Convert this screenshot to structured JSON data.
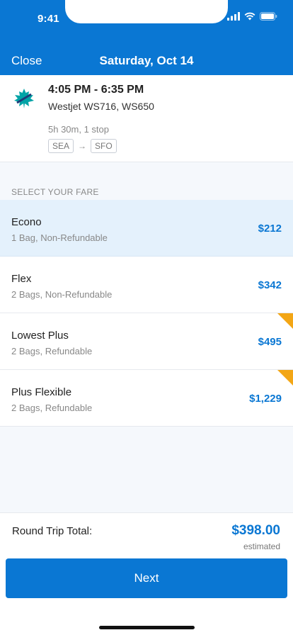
{
  "status_bar": {
    "time": "9:41"
  },
  "header": {
    "close_label": "Close",
    "title": "Saturday, Oct 14"
  },
  "flight": {
    "airline_icon": "westjet-maple-leaf-logo",
    "times": "4:05 PM - 6:35 PM",
    "flight_numbers": "Westjet WS716, WS650",
    "duration": "5h 30m, 1 stop",
    "origin": "SEA",
    "destination": "SFO"
  },
  "fares": {
    "heading": "SELECT YOUR FARE",
    "items": [
      {
        "name": "Econo",
        "detail": "1 Bag, Non-Refundable",
        "price": "$212",
        "selected": true,
        "flagged": false
      },
      {
        "name": "Flex",
        "detail": "2 Bags, Non-Refundable",
        "price": "$342",
        "selected": false,
        "flagged": false
      },
      {
        "name": "Lowest Plus",
        "detail": "2 Bags, Refundable",
        "price": "$495",
        "selected": false,
        "flagged": true
      },
      {
        "name": "Plus Flexible",
        "detail": "2 Bags, Refundable",
        "price": "$1,229",
        "selected": false,
        "flagged": true
      }
    ]
  },
  "total": {
    "label": "Round Trip Total:",
    "amount": "$398.00",
    "note": "estimated"
  },
  "next_label": "Next",
  "colors": {
    "brand": "#0a77d3",
    "flag": "#f3a615",
    "selected_row": "#e4f1fc",
    "logo_teal": "#00a3a6"
  }
}
